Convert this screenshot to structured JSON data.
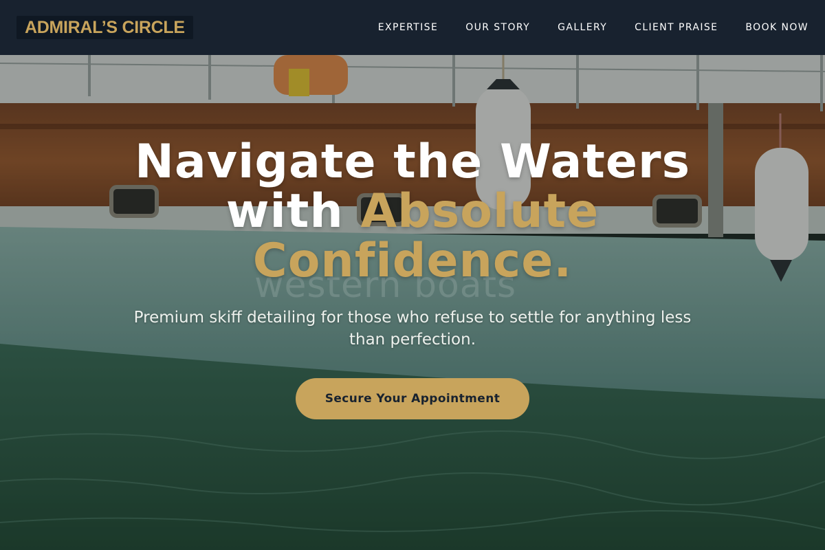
{
  "brand": {
    "logo_text": "ADMIRAL’S CIRCLE",
    "accent_color": "#c8a45c",
    "nav_bg": "#18222f"
  },
  "nav": {
    "items": [
      {
        "label": "EXPERTISE"
      },
      {
        "label": "OUR STORY"
      },
      {
        "label": "GALLERY"
      },
      {
        "label": "CLIENT PRAISE"
      },
      {
        "label": "BOOK NOW"
      }
    ]
  },
  "hero": {
    "headline_line1": "Navigate the Waters",
    "headline_line2_plain": "with ",
    "headline_line2_accent": "Absolute",
    "headline_line3_accent": "Confidence.",
    "subtitle": "Premium skiff detailing for those who refuse to settle for anything less than perfection.",
    "cta_label": "Secure Your Appointment",
    "watermark_text": "western boats"
  }
}
